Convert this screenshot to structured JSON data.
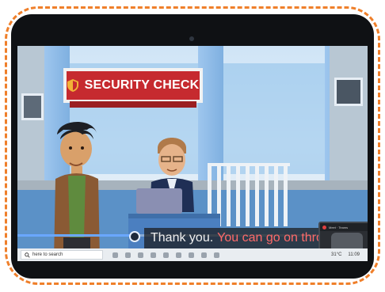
{
  "sign": {
    "text": "SECURITY CHECK"
  },
  "video": {
    "subtitle": {
      "part1": "Thank you.",
      "part2": "You can go on through"
    },
    "progress_fraction": 0.33
  },
  "call_overlay": {
    "title": "Meet · Teams"
  },
  "taskbar": {
    "search_placeholder": "here to search",
    "weather": "31°C",
    "time": "11:09"
  },
  "colors": {
    "frame_border": "#ef7f2a",
    "sign_red": "#c62a2f",
    "subtitle_red": "#ff6a6a"
  }
}
